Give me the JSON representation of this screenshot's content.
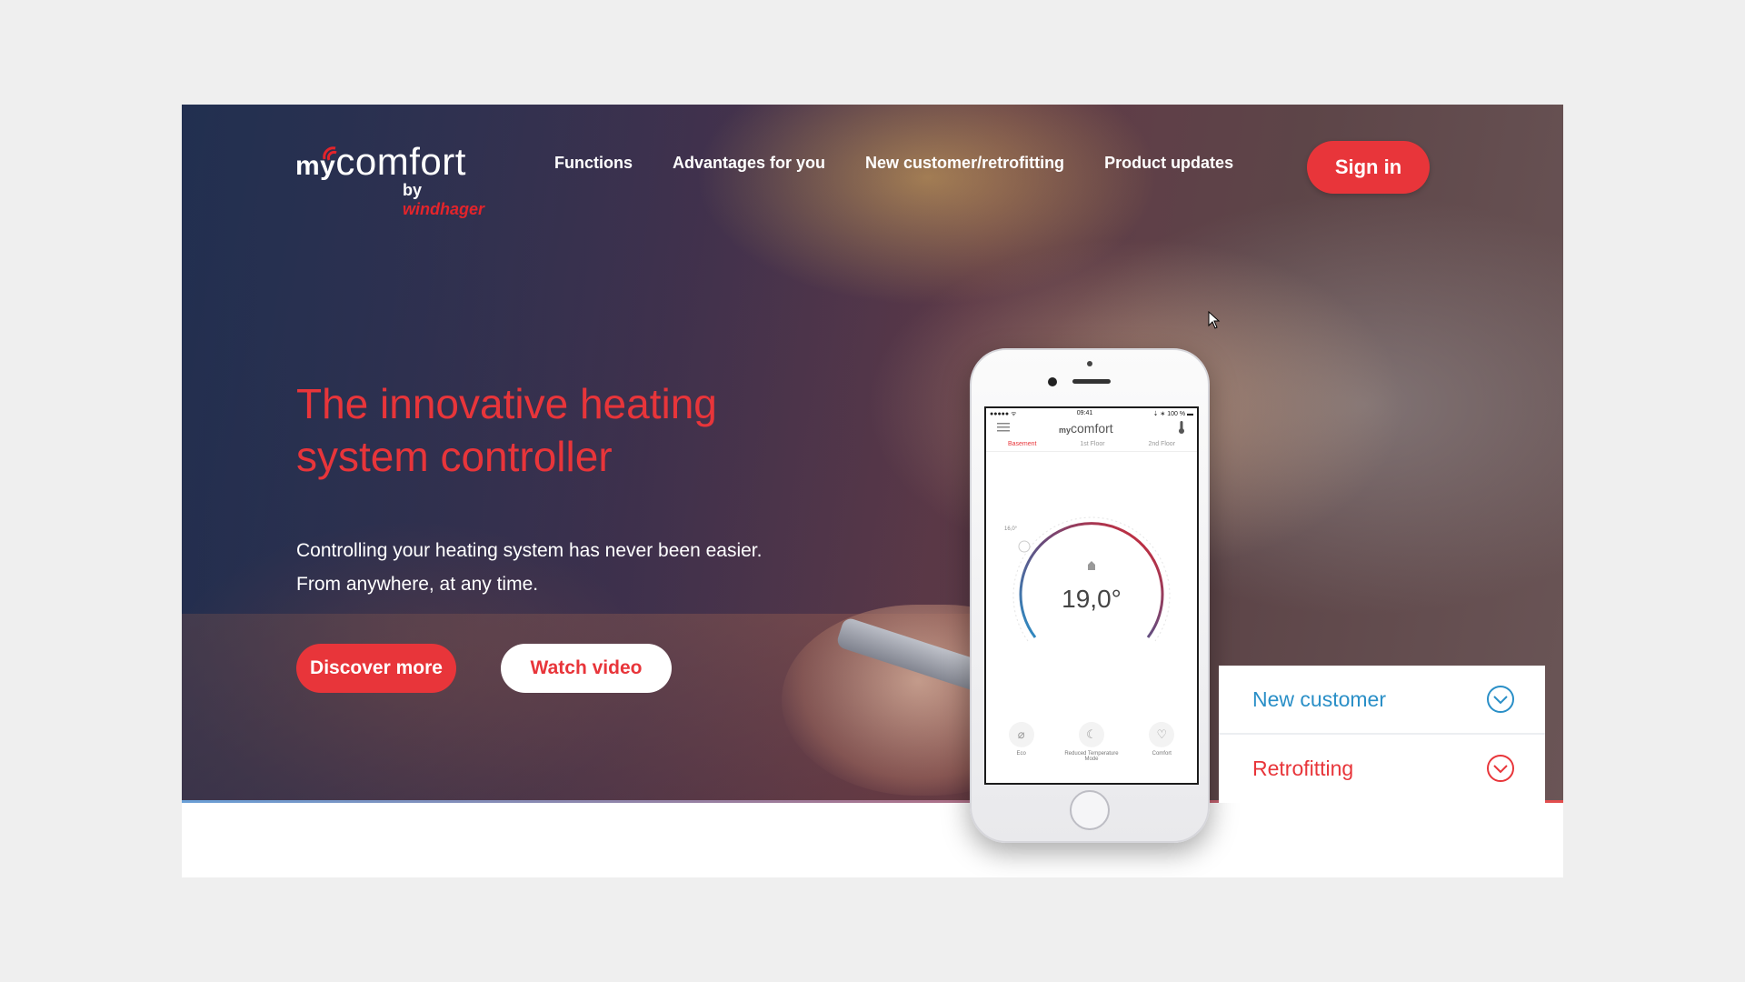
{
  "header": {
    "logo": {
      "my": "my",
      "comfort": "comfort",
      "by": "by",
      "brand": "windhager"
    },
    "nav": [
      "Functions",
      "Advantages for you",
      "New customer/retrofitting",
      "Product updates"
    ],
    "signin_label": "Sign in"
  },
  "hero": {
    "title": "The innovative heating system controller",
    "text": "Controlling your heating system has never been easier. From anywhere, at any time.",
    "primary_button": "Discover more",
    "secondary_button": "Watch video"
  },
  "phone": {
    "status": {
      "carrier": "●●●●● ᯤ",
      "time": "09:41",
      "battery": "⇣ ∗ 100 % ▬"
    },
    "app_logo": {
      "my": "my",
      "comfort": "comfort"
    },
    "floors": [
      "Basement",
      "1st Floor",
      "2nd Floor"
    ],
    "active_floor": "Basement",
    "temperature": "19,0°",
    "dial_side_label": "16,0°",
    "modes": [
      {
        "label": "Eco",
        "icon": "leaf-icon"
      },
      {
        "label": "Reduced Temperature Mode",
        "icon": "moon-icon"
      },
      {
        "label": "Comfort",
        "icon": "heart-icon"
      }
    ]
  },
  "customer_panel": {
    "new_customer": "New customer",
    "retrofitting": "Retrofitting"
  },
  "colors": {
    "accent_red": "#e8353a",
    "accent_blue": "#2a8fc7",
    "background": "#efefef"
  }
}
